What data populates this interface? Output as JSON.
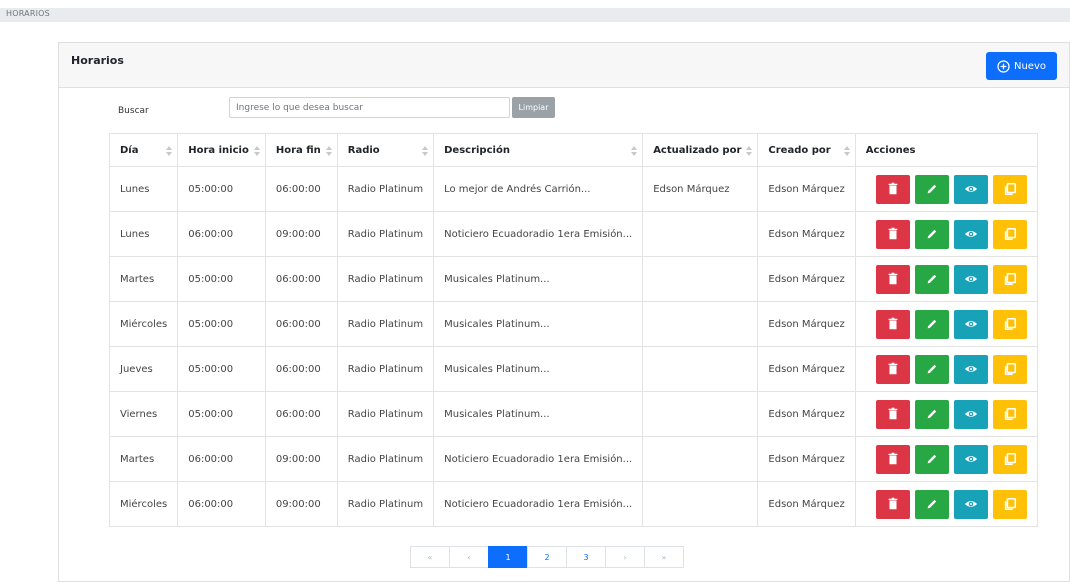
{
  "breadcrumb": "HORARIOS",
  "card": {
    "title": "Horarios",
    "new_button": "Nuevo"
  },
  "search": {
    "label": "Buscar",
    "placeholder": "Ingrese lo que desea buscar",
    "value": "",
    "clear_button": "Limpiar"
  },
  "table": {
    "headers": [
      "Día",
      "Hora inicio",
      "Hora fin",
      "Radio",
      "Descripción",
      "Actualizado por",
      "Creado por",
      "Acciones"
    ],
    "rows": [
      {
        "dia": "Lunes",
        "inicio": "05:00:00",
        "fin": "06:00:00",
        "radio": "Radio Platinum",
        "descripcion": "Lo mejor de Andrés Carrión...",
        "actualizado": "Edson Márquez",
        "creado": "Edson Márquez"
      },
      {
        "dia": "Lunes",
        "inicio": "06:00:00",
        "fin": "09:00:00",
        "radio": "Radio Platinum",
        "descripcion": "Noticiero Ecuadoradio 1era Emisión...",
        "actualizado": "",
        "creado": "Edson Márquez"
      },
      {
        "dia": "Martes",
        "inicio": "05:00:00",
        "fin": "06:00:00",
        "radio": "Radio Platinum",
        "descripcion": "Musicales Platinum...",
        "actualizado": "",
        "creado": "Edson Márquez"
      },
      {
        "dia": "Miércoles",
        "inicio": "05:00:00",
        "fin": "06:00:00",
        "radio": "Radio Platinum",
        "descripcion": "Musicales Platinum...",
        "actualizado": "",
        "creado": "Edson Márquez"
      },
      {
        "dia": "Jueves",
        "inicio": "05:00:00",
        "fin": "06:00:00",
        "radio": "Radio Platinum",
        "descripcion": "Musicales Platinum...",
        "actualizado": "",
        "creado": "Edson Márquez"
      },
      {
        "dia": "Viernes",
        "inicio": "05:00:00",
        "fin": "06:00:00",
        "radio": "Radio Platinum",
        "descripcion": "Musicales Platinum...",
        "actualizado": "",
        "creado": "Edson Márquez"
      },
      {
        "dia": "Martes",
        "inicio": "06:00:00",
        "fin": "09:00:00",
        "radio": "Radio Platinum",
        "descripcion": "Noticiero Ecuadoradio 1era Emisión...",
        "actualizado": "",
        "creado": "Edson Márquez"
      },
      {
        "dia": "Miércoles",
        "inicio": "06:00:00",
        "fin": "09:00:00",
        "radio": "Radio Platinum",
        "descripcion": "Noticiero Ecuadoradio 1era Emisión...",
        "actualizado": "",
        "creado": "Edson Márquez"
      }
    ],
    "actions": [
      {
        "name": "delete",
        "icon": "trash-icon",
        "color": "#dc3545"
      },
      {
        "name": "edit",
        "icon": "pencil-icon",
        "color": "#28a745"
      },
      {
        "name": "view",
        "icon": "eye-icon",
        "color": "#17a2b8"
      },
      {
        "name": "copy",
        "icon": "copy-icon",
        "color": "#ffc107"
      }
    ]
  },
  "pagination": {
    "first": "«",
    "prev": "‹",
    "pages": [
      "1",
      "2",
      "3"
    ],
    "current": "1",
    "next": "›",
    "last": "»"
  },
  "colors": {
    "primary": "#0d6efd",
    "secondary": "#9aa1a7"
  }
}
